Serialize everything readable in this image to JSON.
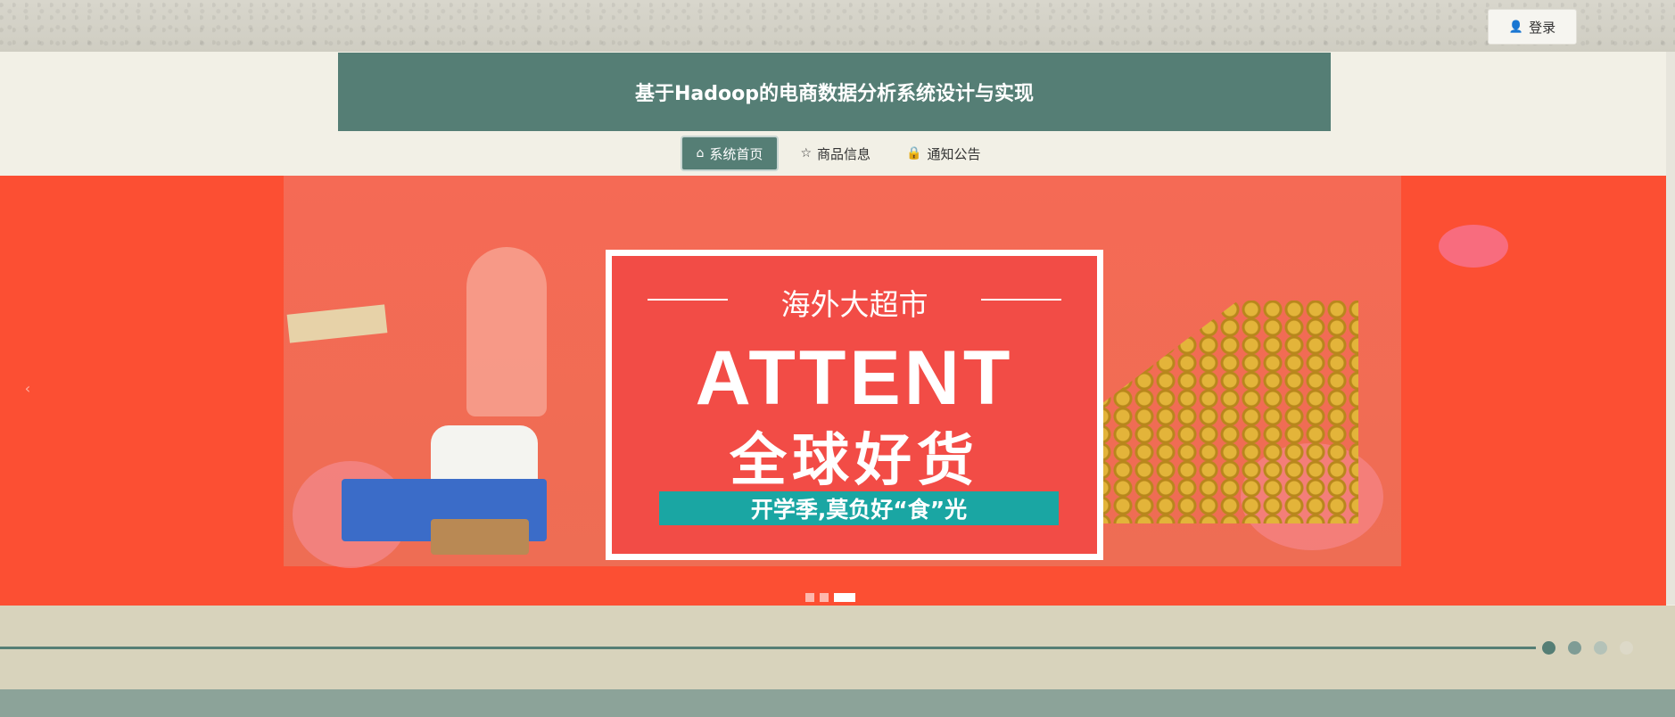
{
  "header": {
    "login_label": "登录",
    "login_icon": "user-icon",
    "site_title": "基于Hadoop的电商数据分析系统设计与实现"
  },
  "nav": {
    "items": [
      {
        "label": "系统首页",
        "icon": "home-icon",
        "active": true
      },
      {
        "label": "商品信息",
        "icon": "star-icon",
        "active": false
      },
      {
        "label": "通知公告",
        "icon": "lock-icon",
        "active": false
      }
    ]
  },
  "banner": {
    "line1": "海外大超市",
    "big_text": "ATTENT",
    "cn_text": "全球好货",
    "strip_text": "开学季,莫负好“食”光",
    "slide_count": 3,
    "active_slide": 3
  },
  "colors": {
    "accent": "#557e75",
    "banner_bg": "#fc4f33",
    "strip": "#1aa6a3"
  },
  "secondary_carousel": {
    "dot_count": 4,
    "active_index": 1
  }
}
